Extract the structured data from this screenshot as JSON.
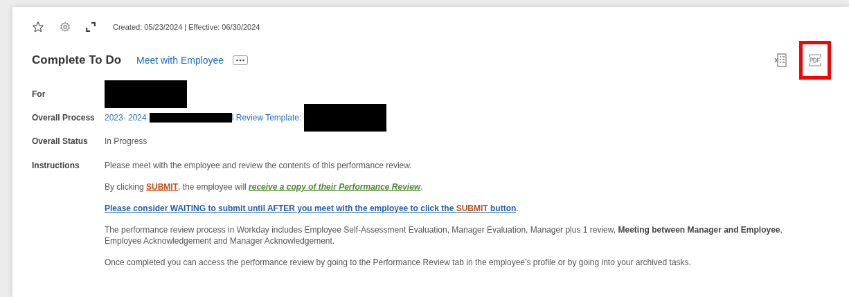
{
  "toolbar": {
    "meta": "Created: 05/23/2024 | Effective: 06/30/2024"
  },
  "header": {
    "title": "Complete To Do",
    "subtitle_link": "Meet with Employee",
    "pdf_highlighted": true
  },
  "fields": [
    {
      "label": "For",
      "parts": [
        {
          "kind": "redacted-block"
        }
      ]
    },
    {
      "label": "Overall Process",
      "parts": [
        {
          "kind": "link",
          "text": "2023- 2024"
        },
        {
          "kind": "redacted-bar"
        },
        {
          "kind": "link",
          "text": "l Review Template:"
        },
        {
          "kind": "redacted-block"
        }
      ]
    },
    {
      "label": "Overall Status",
      "parts": [
        {
          "kind": "text",
          "text": "In Progress"
        }
      ]
    },
    {
      "label": "Instructions",
      "paragraphs": [
        [
          {
            "kind": "plain",
            "text": "Please meet with the employee and review the contents of this performance review."
          }
        ],
        [
          {
            "kind": "plain",
            "text": "By clicking "
          },
          {
            "kind": "submit",
            "text": "SUBMIT"
          },
          {
            "kind": "plain",
            "text": ", the employee will "
          },
          {
            "kind": "green-link",
            "text": "receive a copy of their Performance Review"
          },
          {
            "kind": "plain",
            "text": "."
          }
        ],
        [
          {
            "kind": "blue-link",
            "text": "Please consider WAITING to submit until AFTER you meet with the employee to click the "
          },
          {
            "kind": "submit-in-link",
            "text": "SUBMIT"
          },
          {
            "kind": "blue-link",
            "text": " button"
          },
          {
            "kind": "plain",
            "text": "."
          }
        ],
        [
          {
            "kind": "plain",
            "text": "The performance review process in Workday includes Employee Self-Assessment Evaluation, Manager Evaluation, Manager plus 1 review, "
          },
          {
            "kind": "bold",
            "text": "Meeting between Manager and Employee"
          },
          {
            "kind": "plain",
            "text": ", Employee Acknowledgement and Manager Acknowledgement."
          }
        ],
        [
          {
            "kind": "plain",
            "text": "Once completed you can access the performance review by going to the Performance Review tab in the employee’s profile or by going into your archived tasks."
          }
        ]
      ]
    }
  ]
}
